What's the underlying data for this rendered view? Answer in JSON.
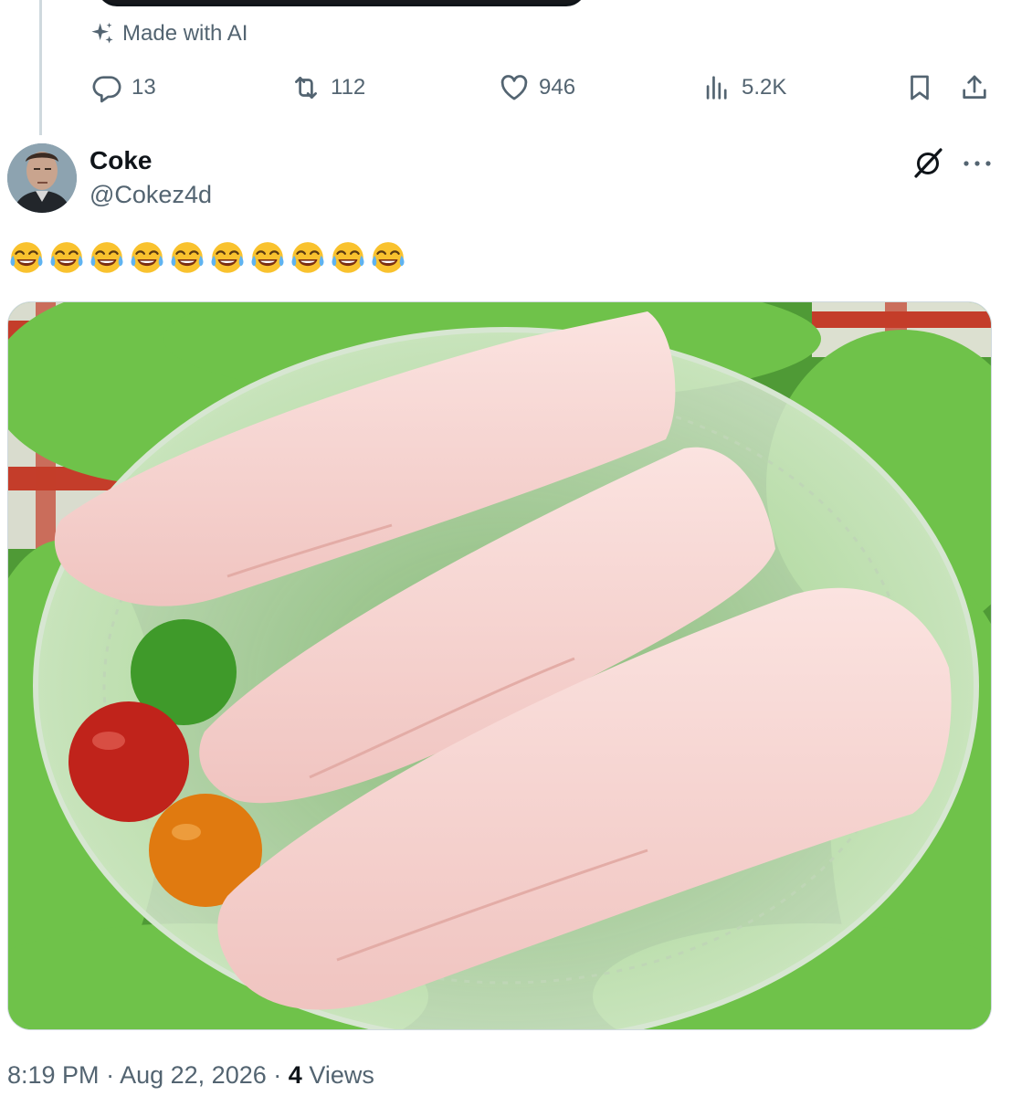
{
  "previous_tweet": {
    "made_with_ai_label": "Made with AI",
    "actions": {
      "replies": "13",
      "reposts": "112",
      "likes": "946",
      "views": "5.2K"
    }
  },
  "tweet": {
    "author_name": "Coke",
    "author_handle": "@Cokez4d",
    "text": "😂😂😂😂😂😂😂😂😂😂",
    "time": "8:19 PM",
    "date": "Aug 22, 2026",
    "views_count": "4",
    "views_label": "Views"
  },
  "icons": {
    "sparkle": "sparkle-icon",
    "reply": "reply-icon",
    "repost": "repost-icon",
    "like": "heart-icon",
    "views": "views-bar-icon",
    "bookmark": "bookmark-icon",
    "share": "share-icon",
    "grok": "grok-icon",
    "more": "more-icon",
    "emoji": "tears-of-joy-emoji"
  },
  "colors": {
    "text_primary": "#0f1419",
    "text_secondary": "#536471",
    "border": "#cfd9de"
  }
}
